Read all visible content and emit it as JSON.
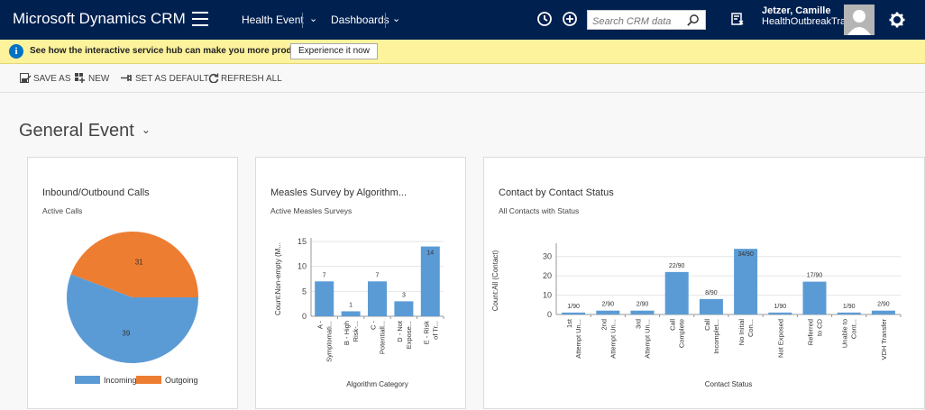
{
  "app": {
    "title": "Microsoft Dynamics CRM"
  },
  "nav": {
    "area": "Health Event",
    "section": "Dashboards"
  },
  "search": {
    "placeholder": "Search CRM data"
  },
  "user": {
    "name": "Jetzer, Camille",
    "org": "HealthOutbreakTra..."
  },
  "notification": {
    "message": "See how the interactive service hub can make you more productive.",
    "button_label": "Experience it now"
  },
  "commands": {
    "save_as": "SAVE AS",
    "new": "NEW",
    "set_default": "SET AS DEFAULT",
    "refresh_all": "REFRESH ALL"
  },
  "dashboard": {
    "title": "General Event"
  },
  "colors": {
    "topbar": "#002050",
    "blue": "#5b9bd5",
    "orange": "#ed7d31",
    "notify": "#fdf39d"
  },
  "cards": {
    "calls": {
      "title": "Inbound/Outbound Calls",
      "view": "Active Calls"
    },
    "measles": {
      "title": "Measles Survey by Algorithm...",
      "view": "Active Measles Surveys"
    },
    "contacts": {
      "title": "Contact by Contact Status",
      "view": "All Contacts with Status"
    }
  },
  "chart_data": [
    {
      "type": "pie",
      "categories": [
        "Incoming",
        "Outgoing"
      ],
      "values": [
        39,
        31
      ],
      "legend": "bottom"
    },
    {
      "type": "bar",
      "categories": [
        "A - Symptomati...",
        "B - High Risk-...",
        "C - Potentiall...",
        "D - Not Expose...",
        "E - Risk of Tr..."
      ],
      "values": [
        7,
        1,
        7,
        3,
        14
      ],
      "data_labels": [
        "7",
        "1",
        "7",
        "3",
        "14"
      ],
      "xlabel": "Algorithm Category",
      "ylabel": "Count:Non-empty (M...",
      "ylim": [
        0,
        15
      ],
      "yticks": [
        0,
        5,
        10,
        15
      ]
    },
    {
      "type": "bar",
      "categories": [
        "1st Attempt Un...",
        "2nd Attempt Un...",
        "3rd Attempt Un...",
        "Call Complete",
        "Call Incomplet...",
        "No Initial Con...",
        "Not Exposed",
        "Referred to CD",
        "Unable to Cont...",
        "VDH Transfer"
      ],
      "values": [
        1,
        2,
        2,
        22,
        8,
        34,
        1,
        17,
        1,
        2
      ],
      "data_labels": [
        "1/90",
        "2/90",
        "2/90",
        "22/90",
        "8/90",
        "34/90",
        "1/90",
        "17/90",
        "1/90",
        "2/90"
      ],
      "xlabel": "Contact Status",
      "ylabel": "Count:All (Contact)",
      "ylim": [
        0,
        35
      ],
      "yticks": [
        0,
        10,
        20,
        30
      ]
    }
  ]
}
